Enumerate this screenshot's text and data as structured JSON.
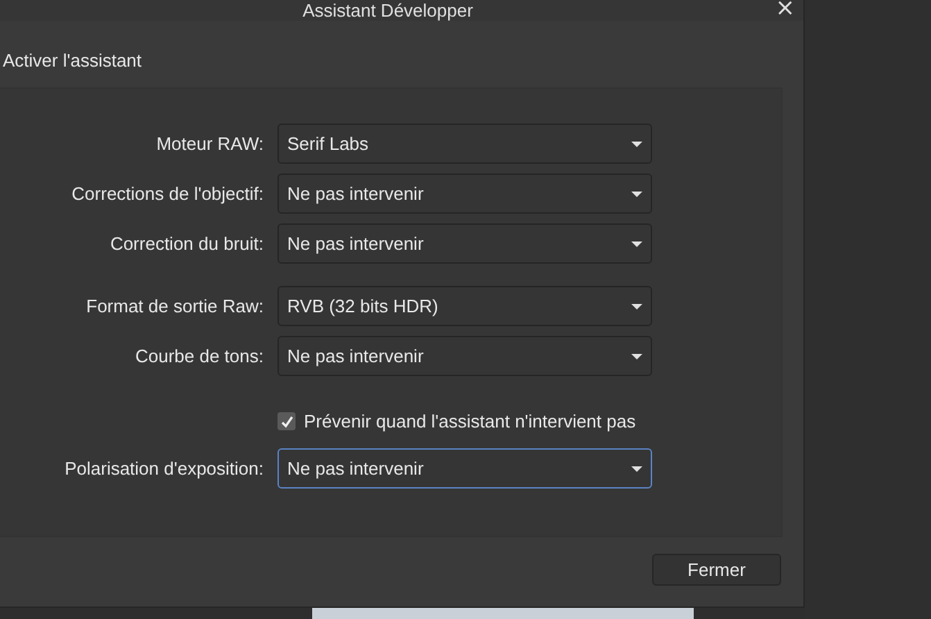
{
  "window": {
    "title": "Assistant Développer",
    "close": "×"
  },
  "heading": "Activer l'assistant",
  "sections": [
    {
      "rows": [
        {
          "kind": "dropdown",
          "label": "Moteur RAW:",
          "value": "Serif Labs",
          "focused": false
        },
        {
          "kind": "dropdown",
          "label": "Corrections de l'objectif:",
          "value": "Ne pas intervenir",
          "focused": false
        },
        {
          "kind": "dropdown",
          "label": "Correction du bruit:",
          "value": "Ne pas intervenir",
          "focused": false
        }
      ]
    },
    {
      "rows": [
        {
          "kind": "dropdown",
          "label": "Format de sortie Raw:",
          "value": "RVB (32 bits HDR)",
          "focused": false
        },
        {
          "kind": "dropdown",
          "label": "Courbe de tons:",
          "value": "Ne pas intervenir",
          "focused": false
        }
      ]
    },
    {
      "rows": [
        {
          "kind": "checkbox",
          "label": "Prévenir quand l'assistant n'intervient pas",
          "checked": true
        },
        {
          "kind": "dropdown",
          "label": "Polarisation d'exposition:",
          "value": "Ne pas intervenir",
          "focused": true
        }
      ]
    }
  ],
  "buttons": [
    "Fermer"
  ]
}
